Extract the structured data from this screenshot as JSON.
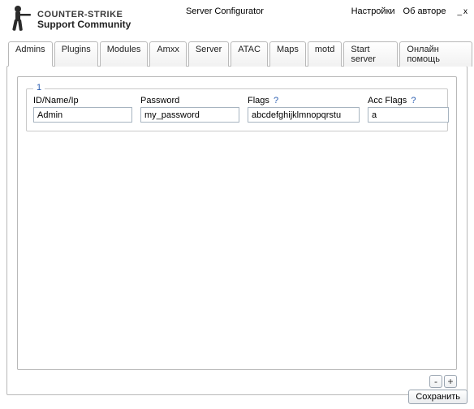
{
  "header": {
    "logo_line1": "COUNTER-STRIKE",
    "logo_line2": "Support Community",
    "title": "Server Configurator",
    "link_settings": "Настройки",
    "link_about": "Об авторе"
  },
  "tabs": [
    {
      "label": "Admins"
    },
    {
      "label": "Plugins"
    },
    {
      "label": "Modules"
    },
    {
      "label": "Amxx"
    },
    {
      "label": "Server"
    },
    {
      "label": "ATAC"
    },
    {
      "label": "Maps"
    },
    {
      "label": "motd"
    },
    {
      "label": "Start server"
    },
    {
      "label": "Онлайн помощь"
    }
  ],
  "admins": {
    "fieldset_label": "1",
    "labels": {
      "id": "ID/Name/Ip",
      "password": "Password",
      "flags": "Flags",
      "accflags": "Acc Flags"
    },
    "help_symbol": "?",
    "values": {
      "id": "Admin",
      "password": "my_password",
      "flags": "abcdefghijklmnopqrstu",
      "accflags": "a"
    }
  },
  "buttons": {
    "remove": "-",
    "add": "+",
    "save": "Сохранить"
  }
}
